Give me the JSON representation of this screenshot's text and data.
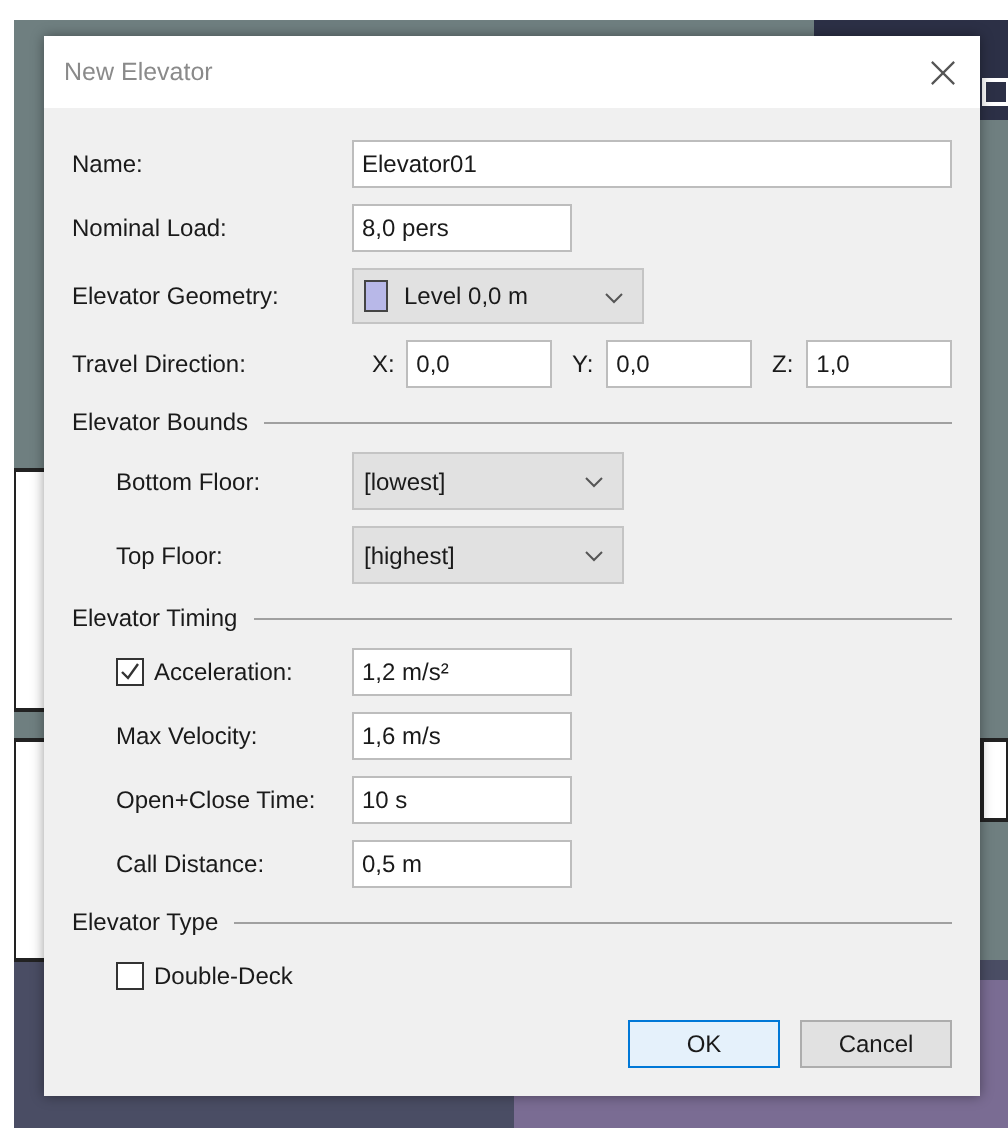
{
  "window": {
    "title": "New Elevator"
  },
  "fields": [
    {
      "kind": "text",
      "label": "Name:",
      "value": "Elevator01"
    },
    {
      "kind": "text",
      "label": "Nominal Load:",
      "value": "8,0 pers"
    },
    {
      "kind": "select",
      "label": "Elevator Geometry:",
      "value": "Level 0,0 m"
    },
    {
      "kind": "vector",
      "label": "Travel Direction:",
      "components": [
        {
          "axis": "X:",
          "value": "0,0"
        },
        {
          "axis": "Y:",
          "value": "0,0"
        },
        {
          "axis": "Z:",
          "value": "1,0"
        }
      ]
    }
  ],
  "sections": [
    {
      "title": "Elevator Bounds",
      "rows": [
        {
          "kind": "select",
          "label": "Bottom Floor:",
          "value": "[lowest]"
        },
        {
          "kind": "select",
          "label": "Top Floor:",
          "value": "[highest]"
        }
      ]
    },
    {
      "title": "Elevator Timing",
      "rows": [
        {
          "kind": "checked_text",
          "label": "Acceleration:",
          "value": "1,2 m/s²",
          "checked": true
        },
        {
          "kind": "text",
          "label": "Max Velocity:",
          "value": "1,6 m/s"
        },
        {
          "kind": "text",
          "label": "Open+Close Time:",
          "value": "10 s"
        },
        {
          "kind": "text",
          "label": "Call Distance:",
          "value": "0,5 m"
        }
      ]
    },
    {
      "title": "Elevator Type",
      "rows": [
        {
          "kind": "checkbox",
          "label": "Double-Deck",
          "checked": false
        }
      ]
    }
  ],
  "buttons": [
    {
      "label": "OK",
      "default": true
    },
    {
      "label": "Cancel",
      "default": false
    }
  ]
}
